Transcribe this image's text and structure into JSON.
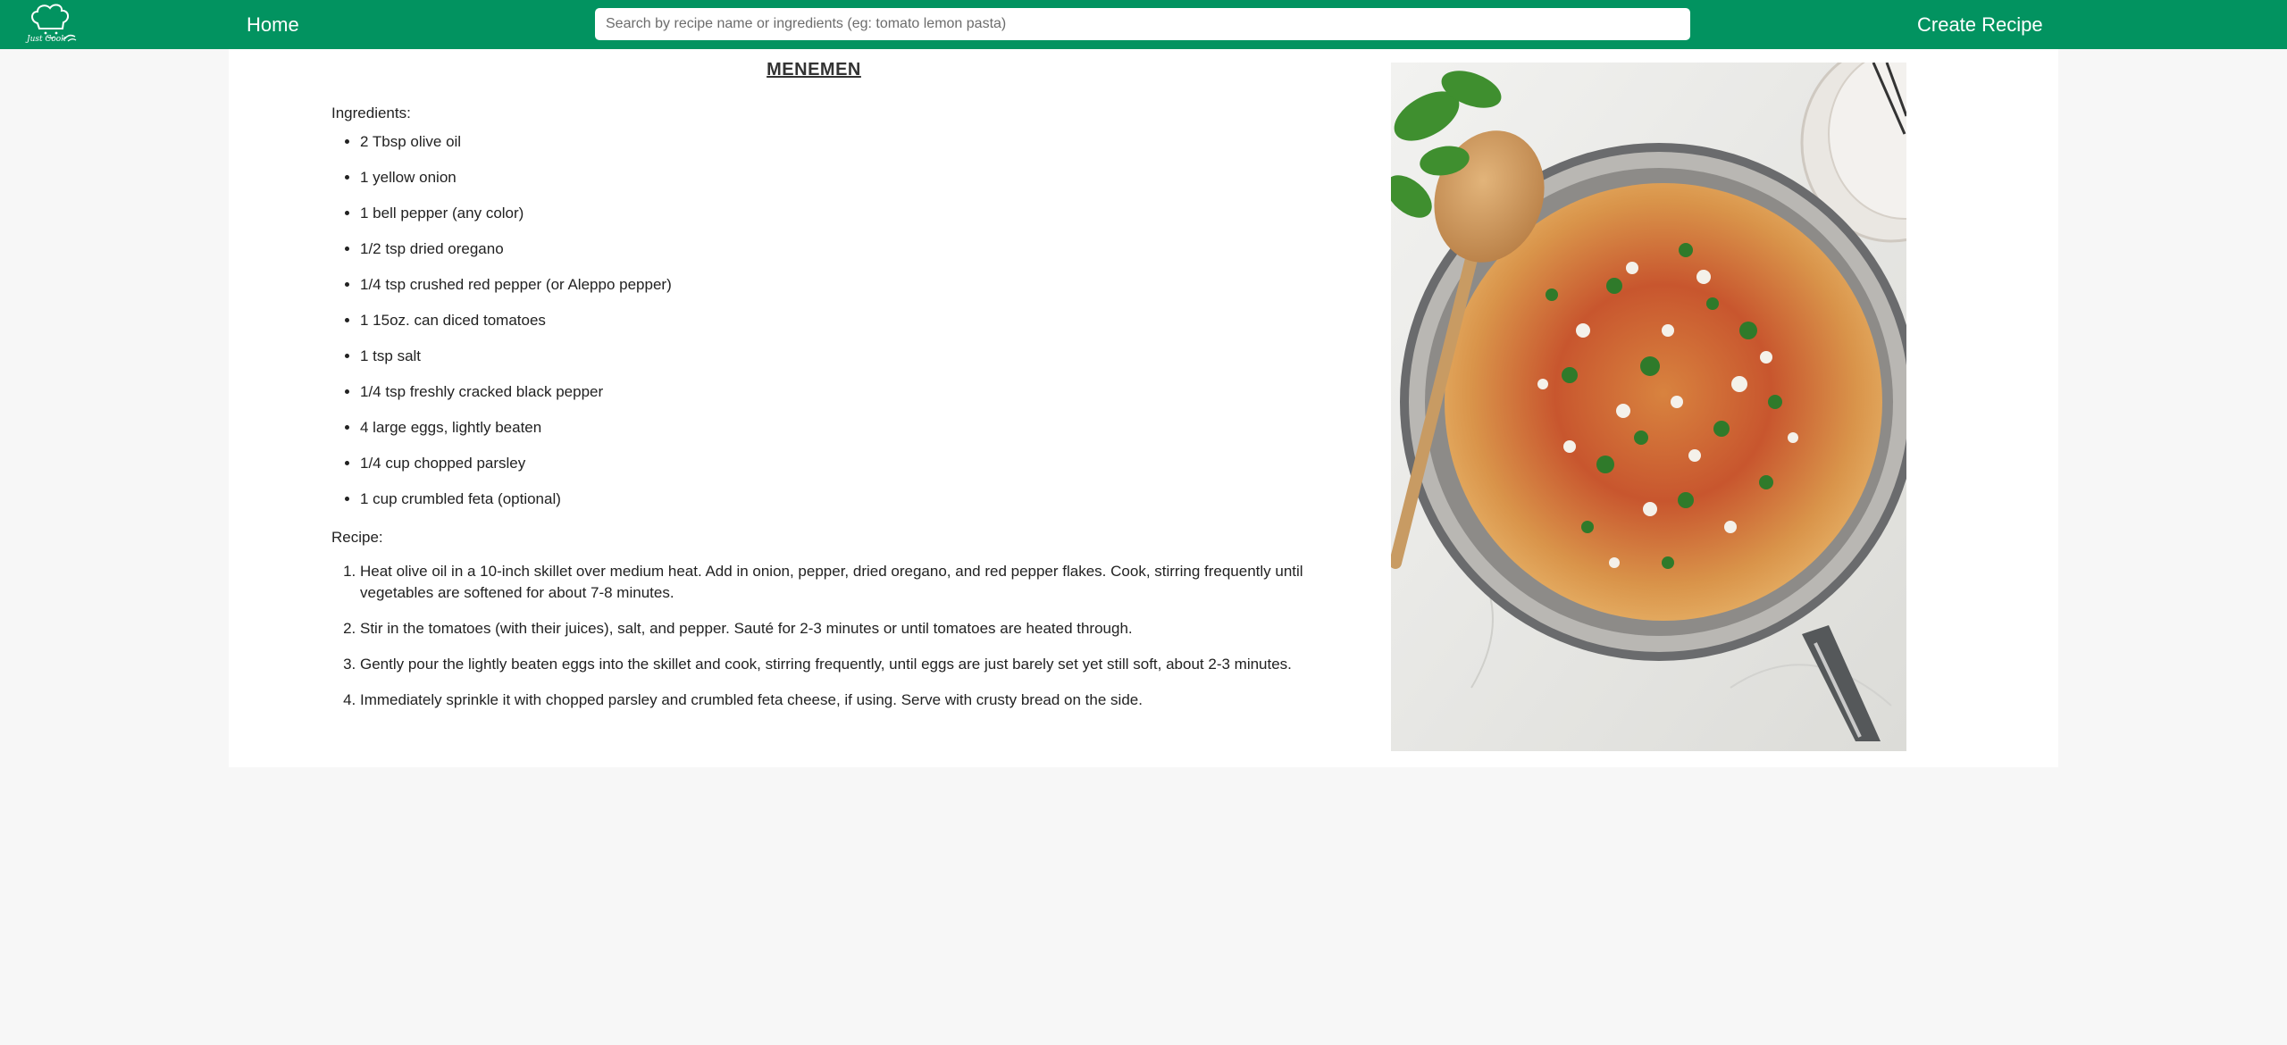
{
  "navbar": {
    "logo_text": "Just Cook",
    "home_label": "Home",
    "search_placeholder": "Search by recipe name or ingredients (eg: tomato lemon pasta)",
    "search_value": "",
    "create_label": "Create Recipe",
    "color": "#029360"
  },
  "recipe": {
    "title": "MENEMEN",
    "ingredients_label": "Ingredients:",
    "ingredients": [
      "2 Tbsp olive oil",
      "1 yellow onion",
      "1 bell pepper (any color)",
      "1/2 tsp dried oregano",
      "1/4 tsp crushed red pepper (or Aleppo pepper)",
      "1 15oz. can diced tomatoes",
      "1 tsp salt",
      "1/4 tsp freshly cracked black pepper",
      "4 large eggs, lightly beaten",
      "1/4 cup chopped parsley",
      "1 cup crumbled feta (optional)"
    ],
    "recipe_label": "Recipe:",
    "steps": [
      "Heat olive oil in a 10-inch skillet over medium heat. Add in onion, pepper, dried oregano, and red pepper flakes. Cook, stirring frequently until vegetables are softened for about 7-8 minutes.",
      "Stir in the tomatoes (with their juices), salt, and pepper. Sauté for 2-3 minutes or until tomatoes are heated through.",
      "Gently pour the lightly beaten eggs into the skillet and cook, stirring frequently, until eggs are just barely set yet still soft, about 2-3 minutes.",
      "Immediately sprinkle it with chopped parsley and crumbled feta cheese, if using. Serve with crusty bread on the side."
    ]
  },
  "icons": {
    "logo": "chef-hat-logo-icon",
    "photo": "menemen-skillet-photo"
  }
}
